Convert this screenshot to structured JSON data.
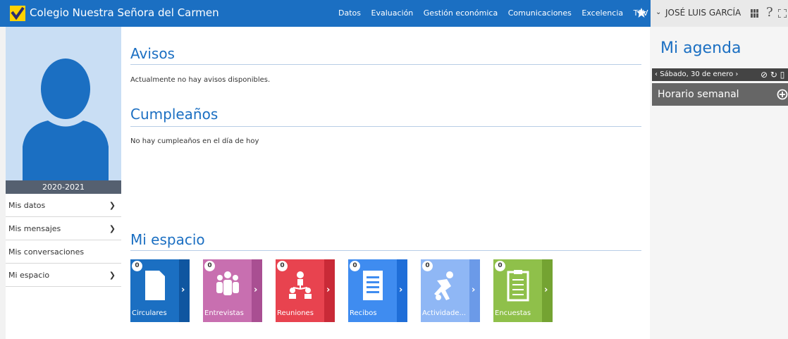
{
  "header": {
    "school_name": "Colegio Nuestra Señora del Carmen",
    "nav": [
      "Datos",
      "Evaluación",
      "Gestión económica",
      "Comunicaciones",
      "Excelencia",
      "TPV"
    ],
    "user_name": "JOSÉ LUIS GARCÍA",
    "help_label": "?",
    "brand_color": "#1b6fc2"
  },
  "sidebar": {
    "year": "2020-2021",
    "items": [
      {
        "label": "Mis datos",
        "expandable": true
      },
      {
        "label": "Mis mensajes",
        "expandable": true
      },
      {
        "label": "Mis conversaciones",
        "expandable": false
      },
      {
        "label": "Mi espacio",
        "expandable": true
      }
    ]
  },
  "main": {
    "avisos_title": "Avisos",
    "avisos_text": "Actualmente no hay avisos disponibles.",
    "cumple_title": "Cumpleaños",
    "cumple_text": "No hay cumpleaños en el día de hoy",
    "espacio_title": "Mi espacio",
    "tiles": [
      {
        "label": "Circulares",
        "count": "0",
        "color": "#1b6fc2",
        "side": "#0f56a0",
        "icon": "document-icon"
      },
      {
        "label": "Entrevistas",
        "count": "0",
        "color": "#c86fb0",
        "side": "#a94f92",
        "icon": "people-icon"
      },
      {
        "label": "Reuniones",
        "count": "0",
        "color": "#e8434f",
        "side": "#c92a37",
        "icon": "meeting-icon"
      },
      {
        "label": "Recibos",
        "count": "0",
        "color": "#3f8cf0",
        "side": "#1f6ed8",
        "icon": "receipt-icon"
      },
      {
        "label": "Actividade...",
        "count": "0",
        "color": "#8fb7f5",
        "side": "#6b9ae8",
        "icon": "activity-icon"
      },
      {
        "label": "Encuestas",
        "count": "0",
        "color": "#8fc04a",
        "side": "#74a332",
        "icon": "survey-icon"
      }
    ]
  },
  "agenda": {
    "title": "Mi agenda",
    "date": "Sábado, 30 de enero",
    "horario": "Horario semanal"
  }
}
